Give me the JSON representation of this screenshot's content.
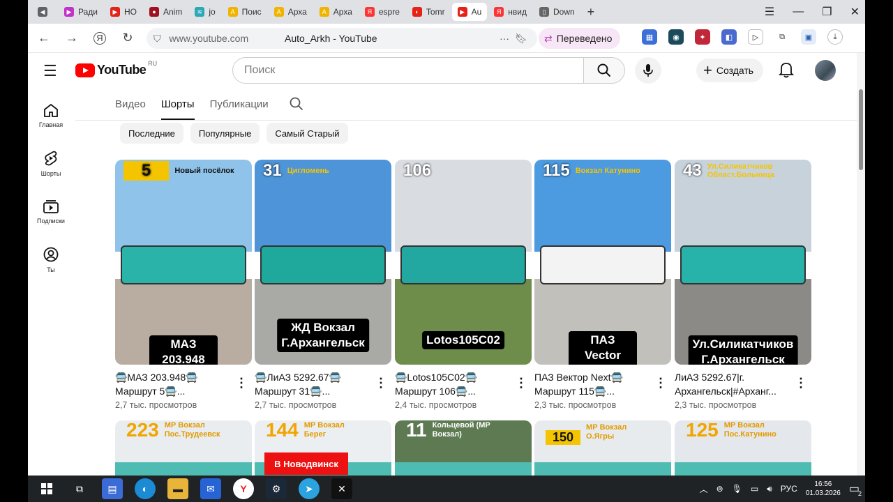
{
  "browser": {
    "tabs": [
      {
        "label": "",
        "color": "#5f6368",
        "glyph": "◀"
      },
      {
        "label": "Ради",
        "color": "#c232c8",
        "glyph": "▶"
      },
      {
        "label": "НО",
        "color": "#e62117",
        "glyph": "▶"
      },
      {
        "label": "Anim",
        "color": "#a01020",
        "glyph": "●"
      },
      {
        "label": "jo",
        "color": "#2aa8b5",
        "glyph": "≋"
      },
      {
        "label": "Поис",
        "color": "#f0b400",
        "glyph": "A"
      },
      {
        "label": "Арха",
        "color": "#f0b400",
        "glyph": "A"
      },
      {
        "label": "Арха",
        "color": "#f0b400",
        "glyph": "A"
      },
      {
        "label": "espre",
        "color": "#f33",
        "glyph": "Я"
      },
      {
        "label": "Tomr",
        "color": "#e62117",
        "glyph": "◐"
      },
      {
        "label": "Au",
        "color": "#e62117",
        "glyph": "▶"
      },
      {
        "label": "нвид",
        "color": "#f33",
        "glyph": "Я"
      },
      {
        "label": "Down",
        "color": "#666",
        "glyph": "▯"
      }
    ],
    "url": "www.youtube.com",
    "page_title": "Auto_Arkh - YouTube",
    "translated_label": "Переведено",
    "window_controls": [
      "☰",
      "—",
      "❐",
      "✕"
    ]
  },
  "youtube": {
    "region": "RU",
    "search_placeholder": "Поиск",
    "create_label": "Создать",
    "guide": [
      {
        "label": "Главная",
        "icon": "home-icon"
      },
      {
        "label": "Шорты",
        "icon": "shorts-icon"
      },
      {
        "label": "Подписки",
        "icon": "subscriptions-icon"
      },
      {
        "label": "Ты",
        "icon": "you-icon"
      }
    ],
    "channel_tabs": [
      "Видео",
      "Шорты",
      "Публикации"
    ],
    "active_tab": "Шорты",
    "chips": [
      "Последние",
      "Популярные",
      "Самый Старый"
    ],
    "shorts": [
      {
        "title": "🚍МАЗ 203.948🚍 Маршрут 5🚍...",
        "views": "2,7 тыс. просмотров",
        "overlay_top": "5",
        "overlay_top2": "Новый посёлок",
        "overlay_caption": "МАЗ 203.948",
        "sky": "#8fc3ea",
        "ground": "#b9ada2",
        "bus": "#2ab3a8"
      },
      {
        "title": "🚍ЛиАЗ 5292.67🚍 Маршрут 31🚍...",
        "views": "2,7 тыс. просмотров",
        "overlay_top": "31",
        "overlay_top2": "Цигломень",
        "overlay_caption": "ЖД Вокзал\nГ.Архангельск",
        "sky": "#4d95d8",
        "ground": "#a9a9a6",
        "bus": "#1fa99d"
      },
      {
        "title": "🚍Lotos105C02🚍 Маршрут 106🚍...",
        "views": "2,4 тыс. просмотров",
        "overlay_top": "106",
        "overlay_top2": "",
        "overlay_caption": "Lotos105C02",
        "sky": "#d9dde2",
        "ground": "#6f8d4a",
        "bus": "#22a8a0"
      },
      {
        "title": "ПАЗ Вектор Next🚍 Маршрут 115🚍...",
        "views": "2,3 тыс. просмотров",
        "overlay_top": "115",
        "overlay_top2": "Вокзал Катунино",
        "overlay_caption": "ПАЗ Vector Next",
        "sky": "#4c9ae0",
        "ground": "#c2c0bb",
        "bus": "#f3f3f3"
      },
      {
        "title": "ЛиАЗ 5292.67|г. Архангельск|#Арханг...",
        "views": "2,3 тыс. просмотров",
        "overlay_top": "43",
        "overlay_top2": "Ул.Силикатчиков Област.Больница",
        "overlay_caption": "Ул.Силикатчиков\nГ.Архангельск",
        "sky": "#c7d2db",
        "ground": "#8c8a86",
        "bus": "#27b3aa"
      }
    ],
    "shorts_row2": [
      {
        "overlay_top": "223",
        "overlay_top2": "МР Вокзал Пос.Трудеевск",
        "sky": "#e9edf0"
      },
      {
        "overlay_top": "144",
        "overlay_top2": "МР Вокзал Берег",
        "banner": "В Новодвинск",
        "sky": "#eceff2"
      },
      {
        "overlay_top": "11",
        "overlay_top2": "Кольцевой (МР Вокзал)",
        "sky": "#5d7a52"
      },
      {
        "overlay_top": "150",
        "overlay_top2": "МР Вокзал О.Ягры",
        "sky": "#e7ebee"
      },
      {
        "overlay_top": "125",
        "overlay_top2": "МР Вокзал Пос.Катунино",
        "sky": "#e4e8ec"
      }
    ]
  },
  "taskbar": {
    "lang": "РУС",
    "time": "16:56",
    "date": "01.03.2026",
    "notifications": "2"
  }
}
